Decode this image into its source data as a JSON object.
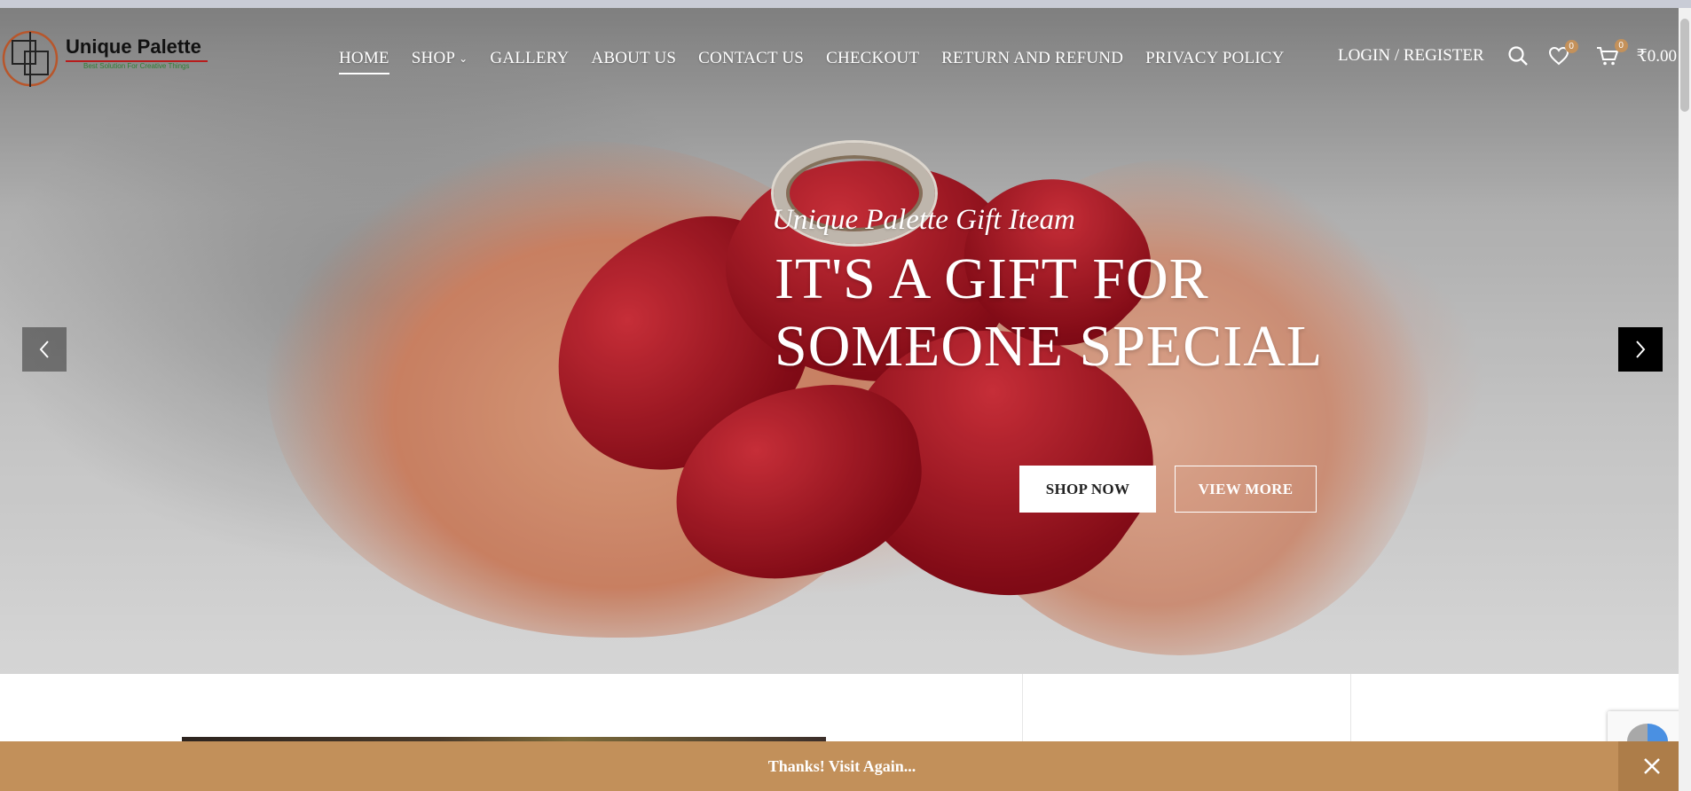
{
  "brand": {
    "name": "Unique Palette",
    "tagline": "Best Solution For Creative Things"
  },
  "nav": {
    "items": [
      {
        "label": "HOME",
        "active": true
      },
      {
        "label": "SHOP",
        "has_dropdown": true
      },
      {
        "label": "GALLERY"
      },
      {
        "label": "ABOUT US"
      },
      {
        "label": "CONTACT US"
      },
      {
        "label": "CHECKOUT"
      },
      {
        "label": "RETURN AND REFUND"
      },
      {
        "label": "PRIVACY POLICY"
      }
    ]
  },
  "header_right": {
    "login_label": "LOGIN / REGISTER",
    "wishlist_count": "0",
    "cart_count": "0",
    "cart_total": "₹0.00",
    "icons": [
      "search-icon",
      "heart-icon",
      "cart-icon"
    ]
  },
  "hero": {
    "subtitle": "Unique Palette Gift Iteam",
    "headline_line1": "IT'S A GIFT FOR",
    "headline_line2": "SOMEONE SPECIAL",
    "primary_button": "SHOP NOW",
    "secondary_button": "VIEW MORE",
    "prev_icon": "chevron-left-icon",
    "next_icon": "chevron-right-icon"
  },
  "notice_bar": {
    "text": "Thanks! Visit Again...",
    "close_icon": "close-icon"
  },
  "colors": {
    "accent": "#c2905a",
    "badge": "#c4915a",
    "text_light": "#ffffff"
  }
}
